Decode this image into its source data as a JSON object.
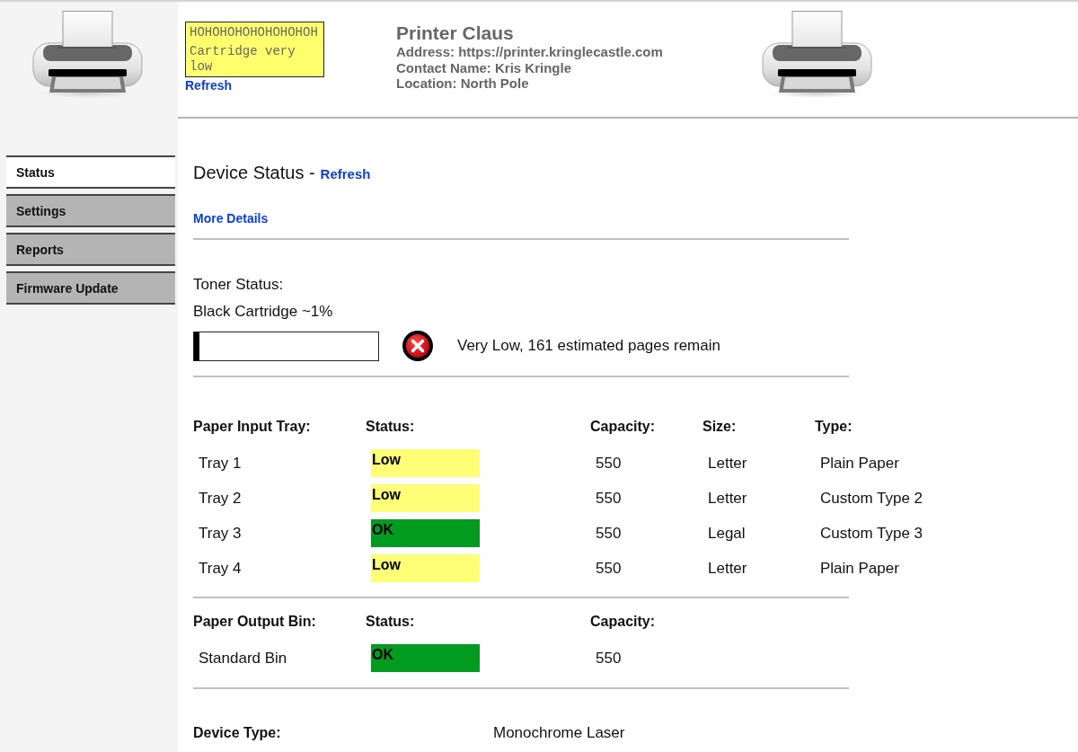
{
  "header": {
    "alert": {
      "lines": [
        "HOHOHOHOHOHOHOHOH",
        "Cartridge very low"
      ]
    },
    "refresh_link": "Refresh",
    "printer": {
      "name": "Printer Claus",
      "details": [
        "Address: https://printer.kringlecastle.com",
        "Contact Name: Kris Kringle",
        "Location: North Pole"
      ]
    }
  },
  "sidebar": {
    "items": [
      {
        "label": "Status",
        "selected": true
      },
      {
        "label": "Settings",
        "selected": false
      },
      {
        "label": "Reports",
        "selected": false
      },
      {
        "label": "Firmware Update",
        "selected": false
      }
    ]
  },
  "device_status": {
    "title": "Device Status -",
    "refresh_link": "Refresh",
    "more_details_link": "More Details"
  },
  "toner": {
    "heading": "Toner Status:",
    "cartridge": "Black Cartridge ~1%",
    "level": 0.03,
    "message": "Very Low, 161 estimated pages remain"
  },
  "input_trays": {
    "columns": [
      "Paper Input Tray:",
      "Status:",
      "Capacity:",
      "Size:",
      "Type:"
    ],
    "rows": [
      {
        "name": "Tray 1",
        "status": "Low",
        "color": "#ffff77",
        "capacity": "550",
        "size": "Letter",
        "type": "Plain Paper"
      },
      {
        "name": "Tray 2",
        "status": "Low",
        "color": "#ffff77",
        "capacity": "550",
        "size": "Letter",
        "type": "Custom Type 2"
      },
      {
        "name": "Tray 3",
        "status": "OK",
        "color": "#009b1f",
        "capacity": "550",
        "size": "Legal",
        "type": "Custom Type 3"
      },
      {
        "name": "Tray 4",
        "status": "Low",
        "color": "#ffff77",
        "capacity": "550",
        "size": "Letter",
        "type": "Plain Paper"
      }
    ]
  },
  "output_bins": {
    "columns": [
      "Paper Output Bin:",
      "Status:",
      "Capacity:"
    ],
    "rows": [
      {
        "name": "Standard Bin",
        "status": "OK",
        "color": "#009b1f",
        "capacity": "550"
      }
    ]
  },
  "device_type": {
    "label": "Device Type:",
    "value": "Monochrome Laser"
  }
}
